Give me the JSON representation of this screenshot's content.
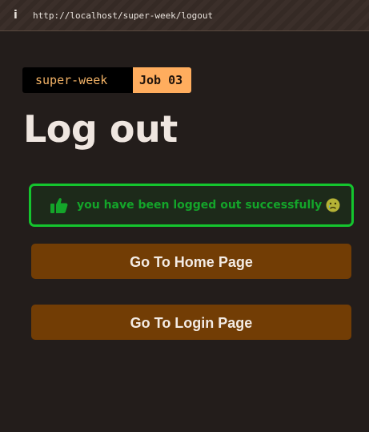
{
  "browser": {
    "info_icon": "i",
    "url": "http://localhost/super-week/logout"
  },
  "badge": {
    "app_name": "super-week",
    "job": "Job 03"
  },
  "page": {
    "title": "Log out"
  },
  "alert": {
    "icon": "thumbs-up-icon",
    "message": "you have been logged out successfully",
    "emoji": "sad-face-icon",
    "border_color": "#14c52e",
    "text_color": "#14a52a"
  },
  "buttons": {
    "home_label": "Go To Home Page",
    "login_label": "Go To Login Page",
    "color": "#723d05"
  }
}
